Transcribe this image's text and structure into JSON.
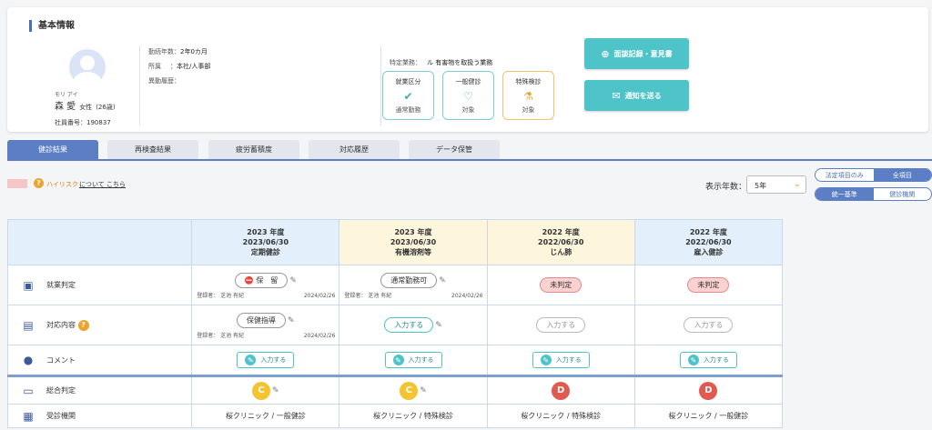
{
  "basic_info": {
    "title": "基本情報",
    "kana": "モリ アイ",
    "name": "森 愛",
    "gender": "女性",
    "age": "(26歳)",
    "emp_no": "社員番号：190837",
    "tenure_label": "勤続年数：",
    "tenure_value": "2年0カ月",
    "dept_label": "所属",
    "dept_value": "：本社/人事部",
    "history_label": "異動履歴："
  },
  "special": {
    "label": "特定業務：",
    "value": "ル 有害物を取扱う業務",
    "boxes": [
      {
        "title": "就業区分",
        "icon": "check-icon",
        "value": "通常勤務"
      },
      {
        "title": "一般健診",
        "icon": "stethoscope-icon",
        "value": "対象"
      },
      {
        "title": "特殊検診",
        "icon": "flask-icon",
        "value": "対象"
      }
    ]
  },
  "actions": {
    "interview_label": "面談記録・意見書",
    "notify_label": "通知を送る"
  },
  "tabs": [
    "健診結果",
    "再検査結果",
    "疲労蓄積度",
    "対応履歴",
    "データ保管"
  ],
  "active_tab": 0,
  "legend": {
    "risk_text": "ハイリスク",
    "link_text": "について こちら"
  },
  "years": {
    "label": "表示年数：",
    "value": "5年"
  },
  "filter_toggle": [
    "法定項目のみ",
    "全項目"
  ],
  "view_toggle": [
    "統一基準",
    "健診機関"
  ],
  "colors": {
    "primary": "#5b7ec4",
    "teal": "#4fc4c8",
    "risk": "#f6c5c5",
    "grade_c": "#f4c430",
    "grade_d": "#e05a4f"
  },
  "table": {
    "columns": [
      {
        "year": "2023 年度",
        "date": "2023/06/30",
        "type": "定期健診",
        "highlight": false
      },
      {
        "year": "2023 年度",
        "date": "2023/06/30",
        "type": "有機溶剤等",
        "highlight": true
      },
      {
        "year": "2022 年度",
        "date": "2022/06/30",
        "type": "じん肺",
        "highlight": true
      },
      {
        "year": "2022 年度",
        "date": "2022/06/30",
        "type": "雇入健診",
        "highlight": false
      }
    ],
    "row_labels": {
      "employment": "就業判定",
      "response": "対応内容",
      "comment": "コメント",
      "overall": "総合判定",
      "institution": "受診機関"
    },
    "employment": [
      "保　留",
      "通常勤務可",
      "未判定",
      "未判定"
    ],
    "response": [
      "保健指導",
      "入力する",
      "入力する",
      "入力する"
    ],
    "registrant": "登録者： 芝池 有紀",
    "reg_date": "2024/02/26",
    "comment_btn": "入力する",
    "grades": [
      "C",
      "C",
      "D",
      "D"
    ],
    "institutions": [
      "桜クリニック / 一般健診",
      "桜クリニック / 特殊検診",
      "桜クリニック / 特殊検診",
      "桜クリニック / 一般健診"
    ]
  }
}
